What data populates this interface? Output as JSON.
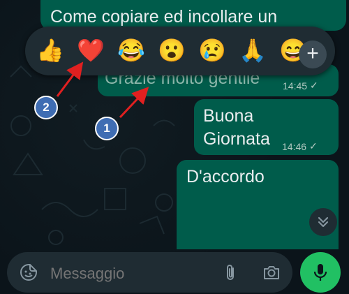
{
  "messages": [
    {
      "text": "Come copiare ed incollare un",
      "time": "",
      "ticks": ""
    },
    {
      "text": "Grazie molto gentile",
      "time": "14:45",
      "ticks": "✓"
    },
    {
      "text": "Buona Giornata",
      "time": "14:46",
      "ticks": "✓"
    },
    {
      "text": "D'accordo",
      "time": "",
      "ticks": ""
    }
  ],
  "reactions": [
    "👍",
    "❤️",
    "😂",
    "😮",
    "😢",
    "🙏",
    "😄"
  ],
  "reaction_more_label": "+",
  "annotations": {
    "badge_1": "1",
    "badge_2": "2"
  },
  "composer": {
    "placeholder": "Messaggio"
  },
  "colors": {
    "background": "#0b141a",
    "outgoing_bubble": "#005c4b",
    "panel": "#1f2c33",
    "accent_green": "#21c063",
    "annotation_blue": "#3f6db3",
    "annotation_arrow": "#e02020"
  },
  "icons": {
    "composer_left": "sticker-icon",
    "attach": "paperclip-icon",
    "camera": "camera-icon",
    "send_voice": "microphone-icon",
    "scroll": "chevron-double-down-icon"
  }
}
